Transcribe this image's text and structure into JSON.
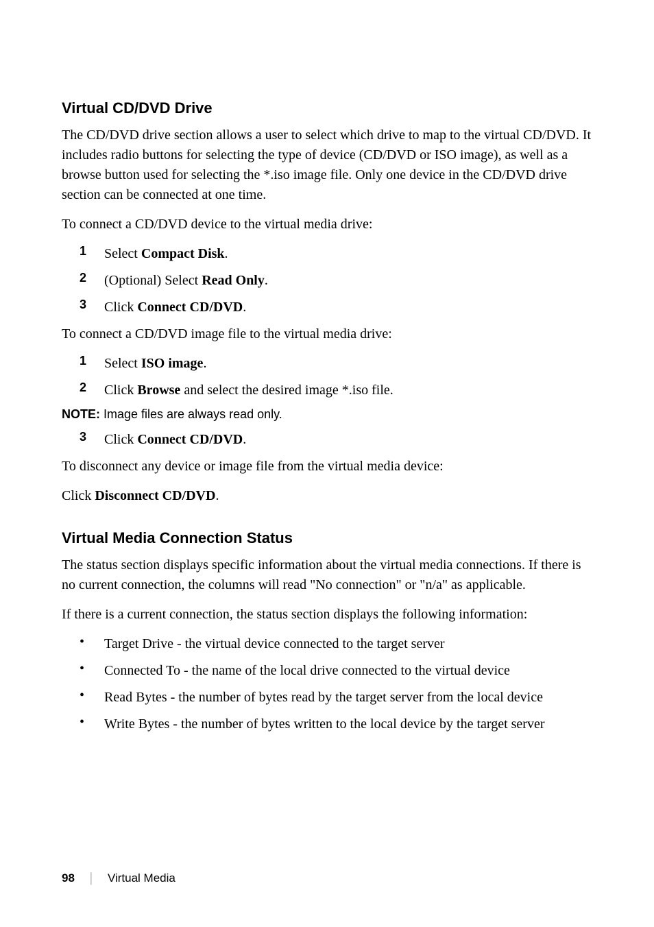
{
  "section1": {
    "heading": "Virtual CD/DVD Drive",
    "p1": "The CD/DVD drive section allows a user to select which drive to map to the virtual CD/DVD. It includes radio buttons for selecting the type of device (CD/DVD or ISO image), as well as a browse button used for selecting the *.iso image file. Only one device in the CD/DVD drive section can be connected at one time.",
    "p2": "To connect a CD/DVD device to the virtual media drive:",
    "list1": {
      "i1": {
        "num": "1",
        "pre": "Select ",
        "bold": "Compact Disk",
        "post": "."
      },
      "i2": {
        "num": "2",
        "pre": "(Optional) Select ",
        "bold": "Read Only",
        "post": "."
      },
      "i3": {
        "num": "3",
        "pre": "Click ",
        "bold": "Connect CD/DVD",
        "post": "."
      }
    },
    "p3": "To connect a CD/DVD image file to the virtual media drive:",
    "list2": {
      "i1": {
        "num": "1",
        "pre": "Select ",
        "bold": "ISO image",
        "post": "."
      },
      "i2": {
        "num": "2",
        "pre": "Click ",
        "bold": "Browse",
        "post": " and select the desired image *.iso file."
      }
    },
    "note": {
      "label": "NOTE:",
      "text": " Image files are always read only."
    },
    "list3": {
      "i3": {
        "num": "3",
        "pre": "Click ",
        "bold": "Connect CD/DVD",
        "post": "."
      }
    },
    "p4": "To disconnect any device or image file from the virtual media device:",
    "p5pre": "Click ",
    "p5bold": "Disconnect CD/DVD",
    "p5post": "."
  },
  "section2": {
    "heading": "Virtual Media Connection Status",
    "p1": "The status section displays specific information about the virtual media connections. If there is no current connection, the columns will read \"No connection\" or \"n/a\" as applicable.",
    "p2": "If there is a current connection, the status section displays the following information:",
    "bullets": {
      "b1": "Target Drive - the virtual device connected to the target server",
      "b2": "Connected To - the name of the local drive connected to the virtual device",
      "b3": "Read Bytes - the number of bytes read by the target server from the local device",
      "b4": "Write Bytes - the number of bytes written to the local device by the target server"
    }
  },
  "footer": {
    "page": "98",
    "sep": "|",
    "title": "Virtual Media"
  }
}
